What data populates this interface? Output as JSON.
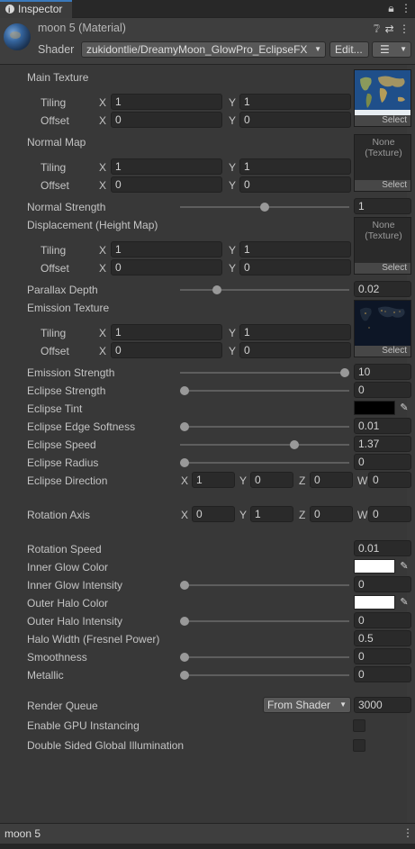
{
  "tab": {
    "title": "Inspector"
  },
  "header": {
    "material_name": "moon 5 (Material)",
    "shader_label": "Shader",
    "shader_value": "zukidontlie/DreamyMoon_GlowPro_EclipseFX",
    "edit_label": "Edit...",
    "list_icon": "☰"
  },
  "main_texture": {
    "label": "Main Texture",
    "tiling_label": "Tiling",
    "offset_label": "Offset",
    "tiling_x": "1",
    "tiling_y": "1",
    "offset_x": "0",
    "offset_y": "0",
    "select": "Select"
  },
  "normal_map": {
    "label": "Normal Map",
    "tiling_label": "Tiling",
    "offset_label": "Offset",
    "tiling_x": "1",
    "tiling_y": "1",
    "offset_x": "0",
    "offset_y": "0",
    "none": "None\n(Texture)",
    "select": "Select"
  },
  "normal_strength": {
    "label": "Normal Strength",
    "value": "1",
    "slider_fraction": 0.5
  },
  "displacement": {
    "label": "Displacement (Height Map)",
    "tiling_label": "Tiling",
    "offset_label": "Offset",
    "tiling_x": "1",
    "tiling_y": "1",
    "offset_x": "0",
    "offset_y": "0",
    "none": "None\n(Texture)",
    "select": "Select"
  },
  "parallax": {
    "label": "Parallax Depth",
    "value": "0.02",
    "slider_fraction": 0.2
  },
  "emission_texture": {
    "label": "Emission Texture",
    "tiling_label": "Tiling",
    "offset_label": "Offset",
    "tiling_x": "1",
    "tiling_y": "1",
    "offset_x": "0",
    "offset_y": "0",
    "select": "Select"
  },
  "emission_strength": {
    "label": "Emission Strength",
    "value": "10",
    "slider_fraction": 1.0
  },
  "eclipse_strength": {
    "label": "Eclipse Strength",
    "value": "0",
    "slider_fraction": 0.0
  },
  "eclipse_tint": {
    "label": "Eclipse Tint",
    "color": "#000000"
  },
  "eclipse_edge": {
    "label": "Eclipse Edge Softness",
    "value": "0.01",
    "slider_fraction": 0.0
  },
  "eclipse_speed": {
    "label": "Eclipse Speed",
    "value": "1.37",
    "slider_fraction": 0.68
  },
  "eclipse_radius": {
    "label": "Eclipse Radius",
    "value": "0",
    "slider_fraction": 0.0
  },
  "eclipse_direction": {
    "label": "Eclipse Direction",
    "x_label": "X",
    "y_label": "Y",
    "z_label": "Z",
    "w_label": "W",
    "x": "1",
    "y": "0",
    "z": "0",
    "w": "0"
  },
  "rotation_axis": {
    "label": "Rotation Axis",
    "x_label": "X",
    "y_label": "Y",
    "z_label": "Z",
    "w_label": "W",
    "x": "0",
    "y": "1",
    "z": "0",
    "w": "0"
  },
  "rotation_speed": {
    "label": "Rotation Speed",
    "value": "0.01"
  },
  "inner_glow_color": {
    "label": "Inner Glow Color",
    "color": "#ffffff"
  },
  "inner_glow_intensity": {
    "label": "Inner Glow Intensity",
    "value": "0",
    "slider_fraction": 0.0
  },
  "outer_halo_color": {
    "label": "Outer Halo Color",
    "color": "#ffffff"
  },
  "outer_halo_intensity": {
    "label": "Outer Halo Intensity",
    "value": "0",
    "slider_fraction": 0.0
  },
  "halo_width": {
    "label": "Halo Width (Fresnel Power)",
    "value": "0.5"
  },
  "smoothness": {
    "label": "Smoothness",
    "value": "0",
    "slider_fraction": 0.0
  },
  "metallic": {
    "label": "Metallic",
    "value": "0",
    "slider_fraction": 0.0
  },
  "render_queue": {
    "label": "Render Queue",
    "mode": "From Shader",
    "value": "3000"
  },
  "gpu_instancing": {
    "label": "Enable GPU Instancing",
    "checked": false
  },
  "double_sided_gi": {
    "label": "Double Sided Global Illumination",
    "checked": false
  },
  "footer": {
    "title": "moon 5",
    "kebab": "⋮"
  },
  "axis": {
    "x": "X",
    "y": "Y"
  }
}
